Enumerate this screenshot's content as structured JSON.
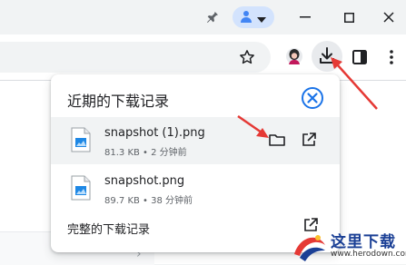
{
  "downloads_popup": {
    "title": "近期的下载记录",
    "items": [
      {
        "name": "snapshot (1).png",
        "meta": "81.3 KB • 2 分钟前"
      },
      {
        "name": "snapshot.png",
        "meta": "89.7 KB • 38 分钟前"
      }
    ],
    "footer_label": "完整的下载记录"
  },
  "watermark": {
    "text": "这里下载",
    "url": "www.herodown.com"
  },
  "colors": {
    "accent_blue": "#1a73e8",
    "arrow_red": "#e53935",
    "icon_gray": "#5f6368"
  },
  "icons": [
    "pin-icon",
    "profile-icon",
    "dropdown-icon",
    "minimize-icon",
    "maximize-icon",
    "close-icon",
    "bookmark-star-icon",
    "extension-avatar-icon",
    "download-icon",
    "side-panel-icon",
    "more-vert-icon",
    "close-circle-icon",
    "image-file-icon",
    "folder-icon",
    "open-external-icon"
  ]
}
